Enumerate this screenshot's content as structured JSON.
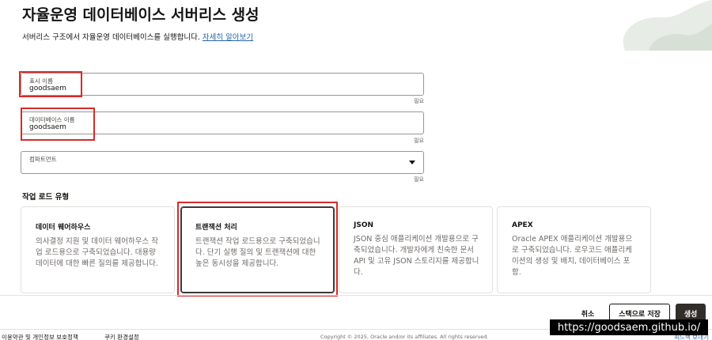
{
  "header": {
    "title": "자율운영 데이터베이스 서버리스 생성",
    "description": "서버리스 구조에서 자율운영 데이터베이스를 실행합니다.",
    "learn_more": "자세히 알아보기"
  },
  "form": {
    "display_name": {
      "label": "표시 이름",
      "value": "goodsaem",
      "required": "필요"
    },
    "db_name": {
      "label": "데이터베이스 이름",
      "value": "goodsaem",
      "required": "필요"
    },
    "compartment": {
      "label": "컴파트먼트",
      "value": "",
      "required": "필요"
    }
  },
  "workload": {
    "title": "작업 로드 유형",
    "selected": "트랜잭션 처리",
    "cards": [
      {
        "title": "데이터 웨어하우스",
        "desc": "의사결정 지원 및 데이터 웨어하우스 작업 로드용으로 구축되었습니다. 대용량 데이터에 대한 빠른 질의를 제공합니다."
      },
      {
        "title": "트랜잭션 처리",
        "desc": "트랜잭션 작업 로드용으로 구축되었습니다. 단기 실행 질의 및 트랜잭션에 대한 높은 동시성을 제공합니다."
      },
      {
        "title": "JSON",
        "desc": "JSON 중심 애플리케이션 개발용으로 구축되었습니다. 개발자에게 친숙한 문서 API 및 고유 JSON 스토리지를 제공합니다."
      },
      {
        "title": "APEX",
        "desc": "Oracle APEX 애플리케이션 개발용으로 구축되었습니다. 로우코드 애플리케이션의 생성 및 배치, 데이터베이스 포함."
      }
    ]
  },
  "actions": {
    "cancel": "취소",
    "save_stack": "스택으로 저장",
    "create": "생성"
  },
  "footer": {
    "privacy": "이용약관 및 개인정보 보호정책",
    "cookies": "쿠키 환경설정",
    "copyright": "Copyright © 2025, Oracle and/or its affiliates. All rights reserved.",
    "feedback": "피드백 보내기"
  },
  "watermark": "https://goodsaem.github.io/",
  "colors": {
    "highlight": "#d52b2b",
    "link": "#2765a9",
    "primary_button": "#312d2a"
  }
}
